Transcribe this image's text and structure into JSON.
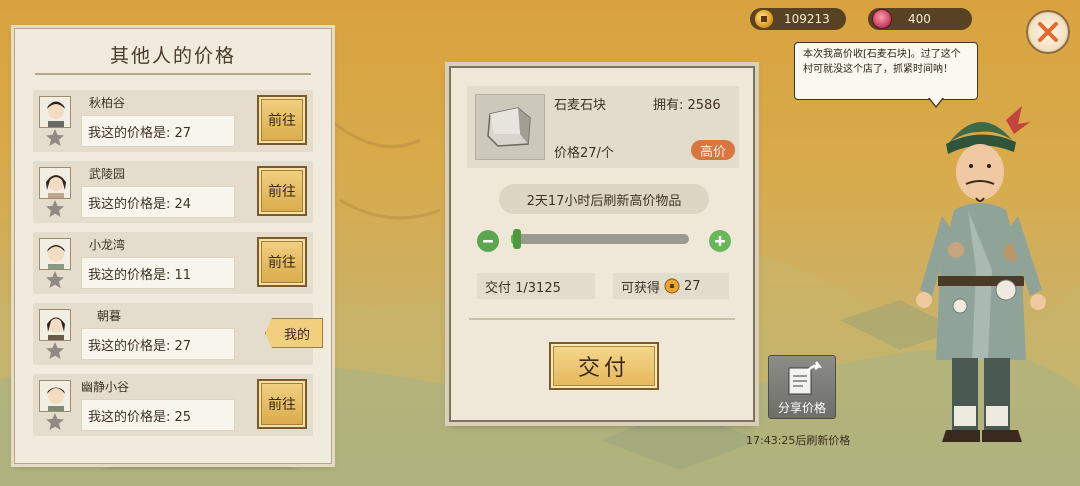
{
  "currency": {
    "coins": "109213",
    "gems": "400",
    "coin_icon": "coin-icon",
    "gem_icon": "gem-icon"
  },
  "close_icon": "close-icon",
  "left_panel": {
    "title": "其他人的价格",
    "rows": [
      {
        "name": "秋柏谷",
        "price_text": "我这的价格是: 27",
        "action": "前往",
        "mine": false
      },
      {
        "name": "武陵园",
        "price_text": "我这的价格是: 24",
        "action": "前往",
        "mine": false
      },
      {
        "name": "小龙湾",
        "price_text": "我这的价格是: 11",
        "action": "前往",
        "mine": false
      },
      {
        "name": "朝暮",
        "price_text": "我这的价格是: 27",
        "action": "我的",
        "mine": true
      },
      {
        "name": "幽静小谷",
        "price_text": "我这的价格是: 25",
        "action": "前往",
        "mine": false
      }
    ]
  },
  "item": {
    "name": "石麦石块",
    "owned": "拥有: 2586",
    "unit_price": "价格27/个",
    "badge": "高价",
    "refresh_notice": "2天17小时后刷新高价物品"
  },
  "quantity": {
    "level": 0.03,
    "deliver_count": "交付 1/3125",
    "reward_label": "可获得",
    "reward_value": "27"
  },
  "deliver_button": "交付",
  "share": {
    "label": "分享价格",
    "refresh_time": "17:43:25后刷新价格"
  },
  "speech": {
    "text": "本次我高价收[石麦石块]。过了这个村可就没这个店了，抓紧时间呐！"
  },
  "colors": {
    "accent_gold": "#e4b65a",
    "badge_orange": "#d9753e",
    "slider_green": "#5cb84a"
  }
}
